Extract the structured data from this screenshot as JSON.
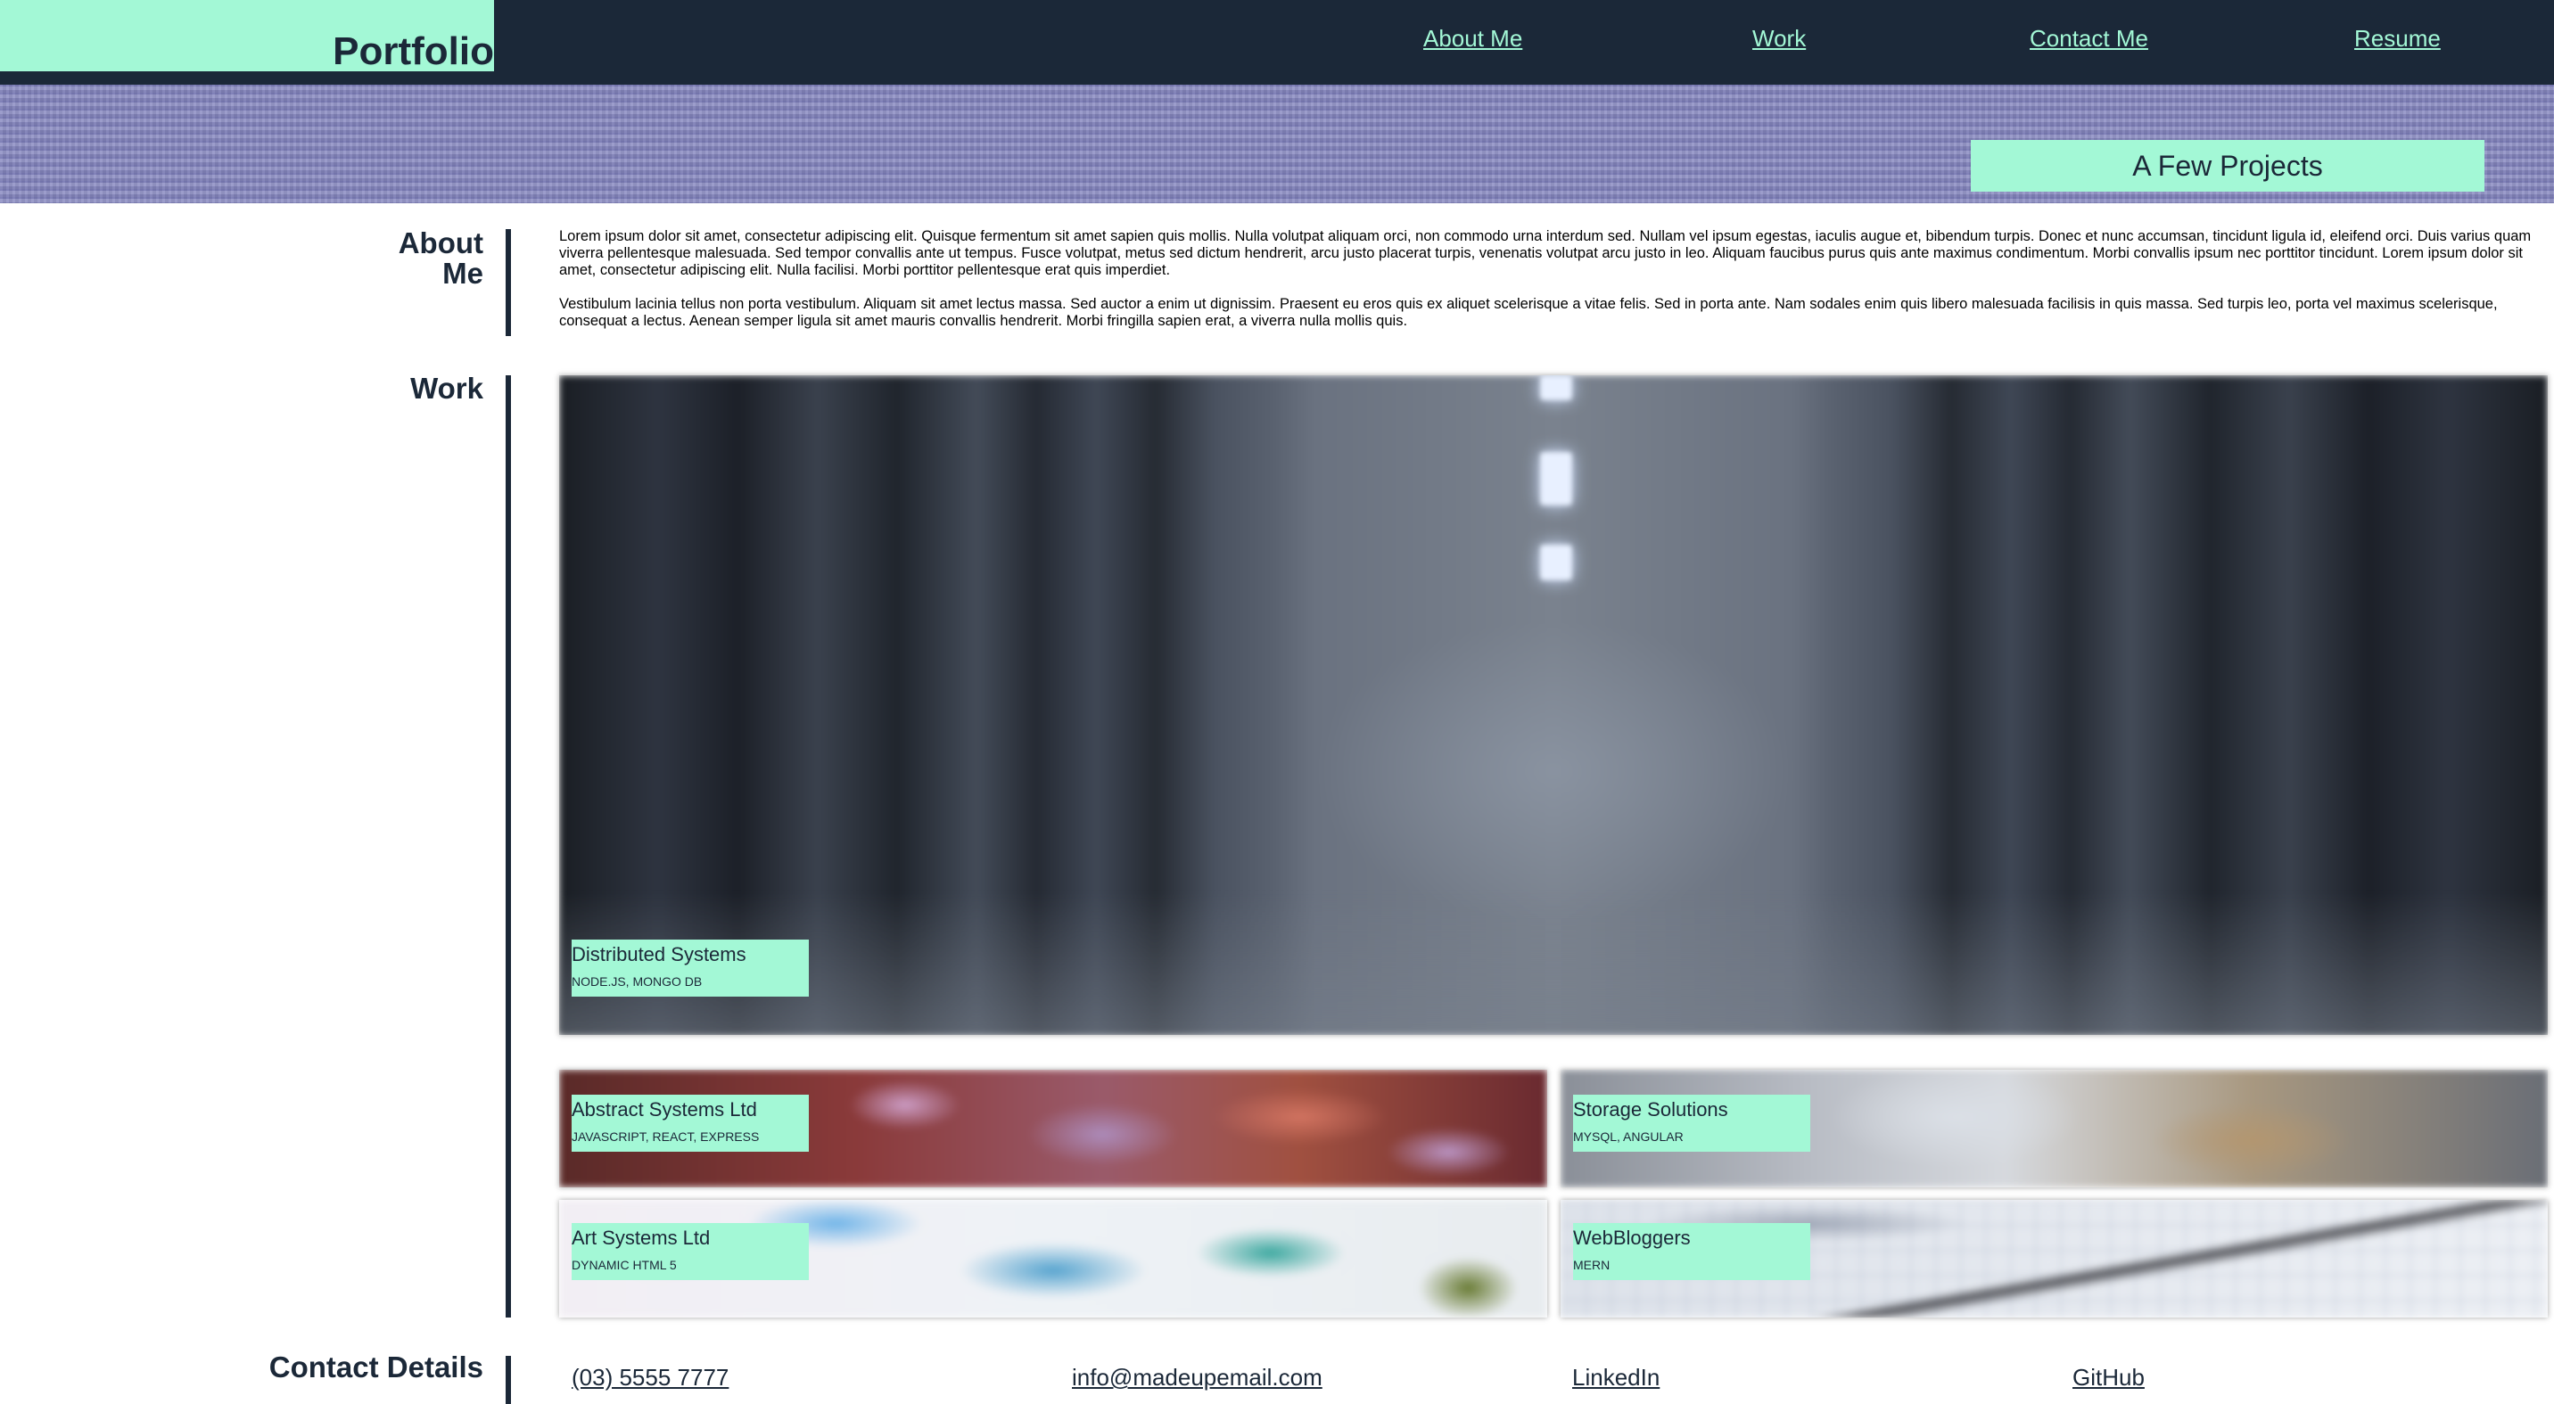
{
  "header": {
    "logo": "Portfolio",
    "nav": {
      "about": "About Me",
      "work": "Work",
      "contact": "Contact Me",
      "resume": "Resume"
    }
  },
  "banner": {
    "heading": "A Few Projects"
  },
  "about": {
    "label_line1": "About",
    "label_line2": "Me",
    "paragraphs": [
      "Lorem ipsum dolor sit amet, consectetur adipiscing elit. Quisque fermentum sit amet sapien quis mollis. Nulla volutpat aliquam orci, non commodo urna interdum sed. Nullam vel ipsum egestas, iaculis augue et, bibendum turpis. Donec et nunc accumsan, tincidunt ligula id, eleifend orci. Duis varius quam viverra pellentesque malesuada. Sed tempor convallis ante ut tempus. Fusce volutpat, metus sed dictum hendrerit, arcu justo placerat turpis, venenatis volutpat arcu justo in leo. Aliquam faucibus purus quis ante maximus condimentum. Morbi convallis ipsum nec porttitor tincidunt. Lorem ipsum dolor sit amet, consectetur adipiscing elit. Nulla facilisi. Morbi porttitor pellentesque erat quis imperdiet.",
      "Vestibulum lacinia tellus non porta vestibulum. Aliquam sit amet lectus massa. Sed auctor a enim ut dignissim. Praesent eu eros quis ex aliquet scelerisque a vitae felis. Sed in porta ante. Nam sodales enim quis libero malesuada facilisis in quis massa. Sed turpis leo, porta vel maximus scelerisque, consequat a lectus. Aenean semper ligula sit amet mauris convallis hendrerit. Morbi fringilla sapien erat, a viverra nulla mollis quis."
    ]
  },
  "work": {
    "label": "Work",
    "projects": [
      {
        "title": "Distributed Systems",
        "tech": "NODE.JS, MONGO DB"
      },
      {
        "title": "Abstract Systems Ltd",
        "tech": "JAVASCRIPT, REACT, EXPRESS"
      },
      {
        "title": "Storage Solutions",
        "tech": "MYSQL, ANGULAR"
      },
      {
        "title": "Art Systems Ltd",
        "tech": "DYNAMIC HTML 5"
      },
      {
        "title": "WebBloggers",
        "tech": "MERN"
      }
    ]
  },
  "contact": {
    "label": "Contact Details",
    "phone": "(03) 5555 7777",
    "email": "info@madeupemail.com",
    "linkedin": "LinkedIn",
    "github": "GitHub"
  },
  "colors": {
    "navy": "#1b2838",
    "mint": "#a3f8d6",
    "banner": "#8a8bc2"
  }
}
